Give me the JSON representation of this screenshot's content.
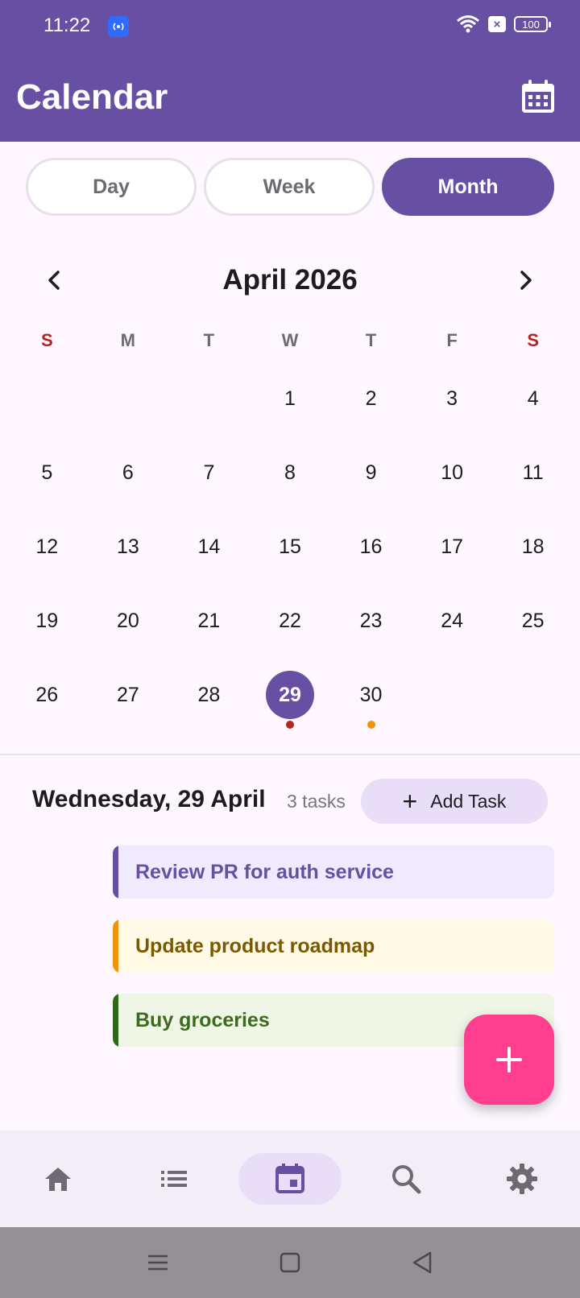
{
  "status_bar": {
    "time": "11:22",
    "battery": "100"
  },
  "app_bar": {
    "title": "Calendar"
  },
  "view_tabs": [
    {
      "label": "Day",
      "selected": false
    },
    {
      "label": "Week",
      "selected": false
    },
    {
      "label": "Month",
      "selected": true
    }
  ],
  "month_nav": {
    "title": "April 2026"
  },
  "weekdays": [
    "S",
    "M",
    "T",
    "W",
    "T",
    "F",
    "S"
  ],
  "weeks": [
    [
      "",
      "",
      "",
      "1",
      "2",
      "3",
      "4"
    ],
    [
      "5",
      "6",
      "7",
      "8",
      "9",
      "10",
      "11"
    ],
    [
      "12",
      "13",
      "14",
      "15",
      "16",
      "17",
      "18"
    ],
    [
      "19",
      "20",
      "21",
      "22",
      "23",
      "24",
      "25"
    ],
    [
      "26",
      "27",
      "28",
      "29",
      "30",
      "",
      ""
    ]
  ],
  "selected_day": "29",
  "event_dots": {
    "29": "#B3261E",
    "30": "#F2930E"
  },
  "day_detail": {
    "date": "Wednesday, 29 April",
    "count": "3 tasks",
    "add_label": "Add Task"
  },
  "tasks": [
    {
      "title": "Review PR for auth service",
      "accent": "#6750A4"
    },
    {
      "title": "Update product roadmap",
      "accent": "#F2930E"
    },
    {
      "title": "Buy groceries",
      "accent": "#2E6A1A"
    }
  ],
  "fab": {
    "icon": "plus-icon"
  },
  "bottom_nav": [
    {
      "name": "home",
      "icon": "home-icon",
      "active": false
    },
    {
      "name": "list",
      "icon": "list-icon",
      "active": false
    },
    {
      "name": "calendar",
      "icon": "calendar-icon",
      "active": true
    },
    {
      "name": "search",
      "icon": "search-icon",
      "active": false
    },
    {
      "name": "settings",
      "icon": "settings-icon",
      "active": false
    }
  ],
  "colors": {
    "primary": "#6750A4",
    "fab": "#FF3E8F",
    "weekend": "#B3261E"
  }
}
